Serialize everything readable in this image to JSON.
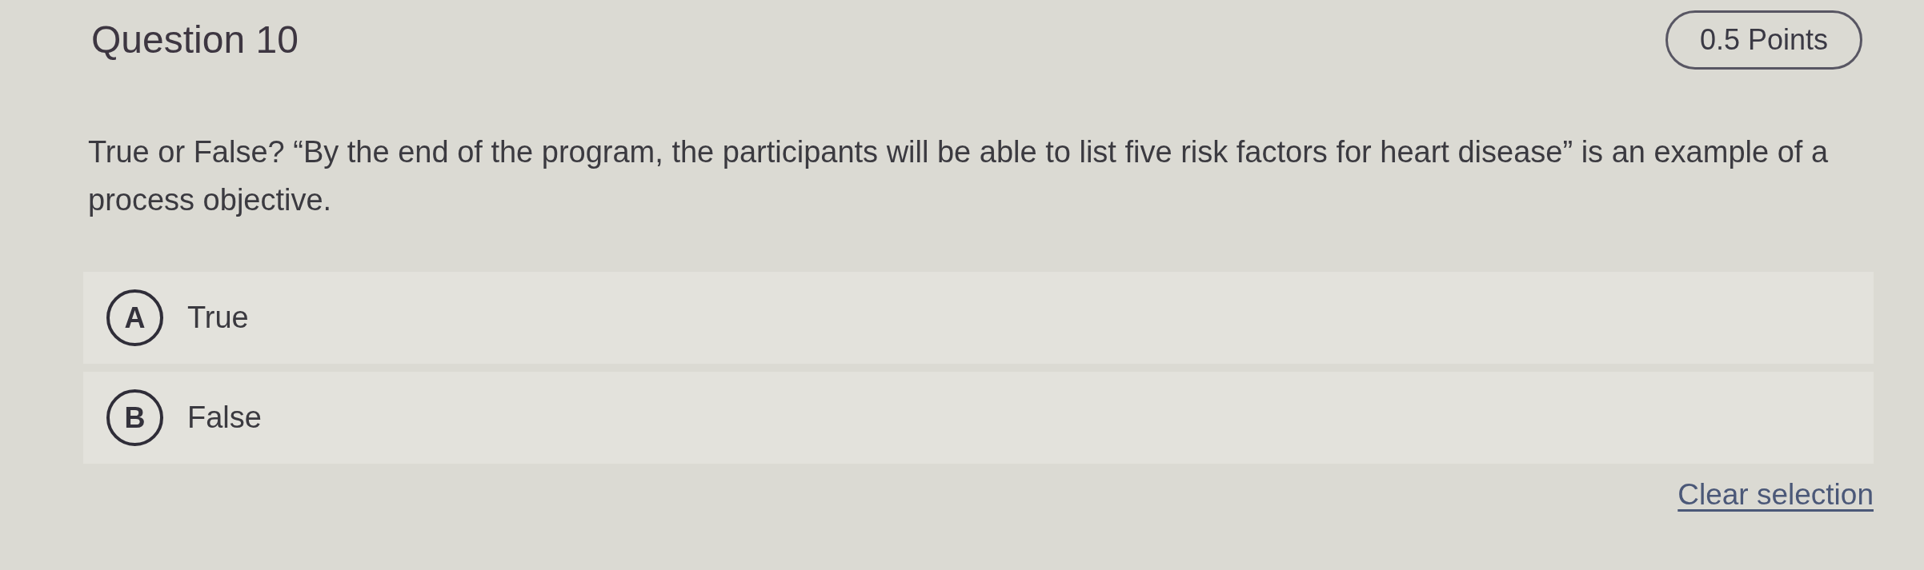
{
  "question": {
    "title": "Question 10",
    "points": "0.5 Points",
    "prompt": "True or False? “By the end of the program, the participants will be able to list five risk factors for heart disease” is an example of a process objective."
  },
  "options": [
    {
      "letter": "A",
      "label": "True",
      "selected": false
    },
    {
      "letter": "B",
      "label": "False",
      "selected": false
    }
  ],
  "clear_selection": "Clear selection"
}
